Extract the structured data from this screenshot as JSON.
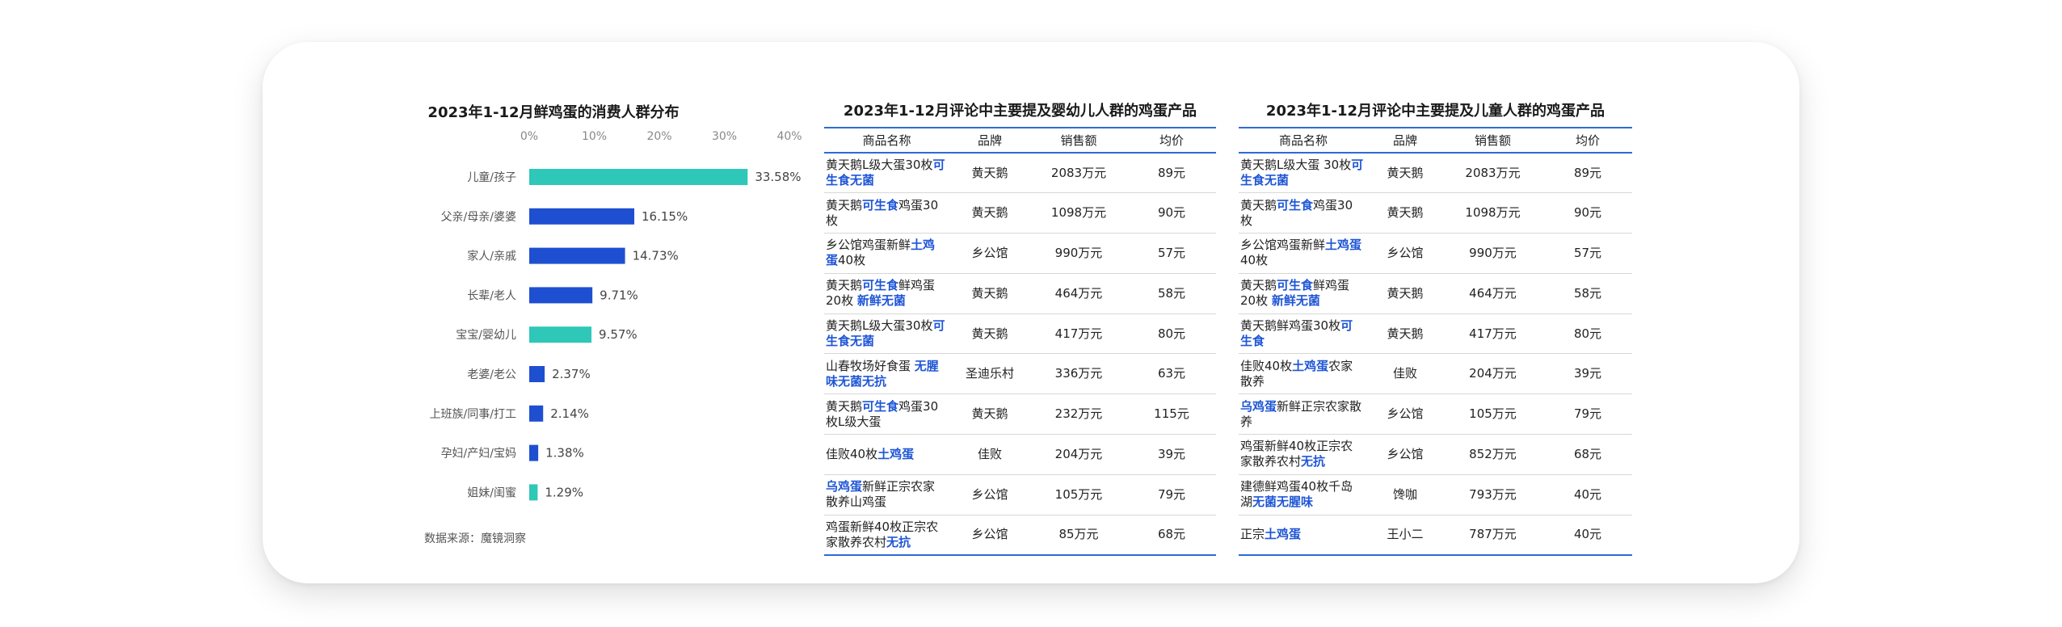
{
  "chart_data": {
    "type": "bar",
    "orientation": "horizontal",
    "title": "2023年1-12月鲜鸡蛋的消费人群分布",
    "xlim": [
      0,
      40
    ],
    "x_ticks": [
      "0%",
      "10%",
      "20%",
      "30%",
      "40%"
    ],
    "categories": [
      "儿童/孩子",
      "父亲/母亲/婆婆",
      "家人/亲戚",
      "长辈/老人",
      "宝宝/婴幼儿",
      "老婆/老公",
      "上班族/同事/打工",
      "孕妇/产妇/宝妈",
      "姐妹/闺蜜"
    ],
    "values": [
      33.58,
      16.15,
      14.73,
      9.71,
      9.57,
      2.37,
      2.14,
      1.38,
      1.29
    ],
    "value_labels": [
      "33.58%",
      "16.15%",
      "14.73%",
      "9.71%",
      "9.57%",
      "2.37%",
      "2.14%",
      "1.38%",
      "1.29%"
    ],
    "bar_colors": [
      "#2ec7b8",
      "#1f4fd1",
      "#1f4fd1",
      "#1f4fd1",
      "#2ec7b8",
      "#1f4fd1",
      "#1f4fd1",
      "#1f4fd1",
      "#2ec7b8"
    ]
  },
  "source_note": "数据来源：魔镜洞察",
  "tables": [
    {
      "title": "2023年1-12月评论中主要提及婴幼儿人群的鸡蛋产品",
      "columns": [
        "商品名称",
        "品牌",
        "销售额",
        "均价"
      ],
      "rows": [
        {
          "name": [
            [
              "黄天鹅L级大蛋30枚",
              false
            ],
            [
              "可生食无菌",
              true
            ]
          ],
          "brand": "黄天鹅",
          "sales": "2083万元",
          "price": "89元"
        },
        {
          "name": [
            [
              "黄天鹅",
              false
            ],
            [
              "可生食",
              true
            ],
            [
              "鸡蛋30枚",
              false
            ]
          ],
          "brand": "黄天鹅",
          "sales": "1098万元",
          "price": "90元"
        },
        {
          "name": [
            [
              "乡公馆鸡蛋新鲜",
              false
            ],
            [
              "土鸡蛋",
              true
            ],
            [
              "40枚",
              false
            ]
          ],
          "brand": "乡公馆",
          "sales": "990万元",
          "price": "57元"
        },
        {
          "name": [
            [
              "黄天鹅",
              false
            ],
            [
              "可生食",
              true
            ],
            [
              "鲜鸡蛋20枚 ",
              false
            ],
            [
              "新鲜无菌",
              true
            ]
          ],
          "brand": "黄天鹅",
          "sales": "464万元",
          "price": "58元"
        },
        {
          "name": [
            [
              "黄天鹅L级大蛋30枚",
              false
            ],
            [
              "可生食无菌",
              true
            ]
          ],
          "brand": "黄天鹅",
          "sales": "417万元",
          "price": "80元"
        },
        {
          "name": [
            [
              "山春牧场好食蛋 ",
              false
            ],
            [
              "无腥味无菌无抗",
              true
            ]
          ],
          "brand": "圣迪乐村",
          "sales": "336万元",
          "price": "63元"
        },
        {
          "name": [
            [
              "黄天鹅",
              false
            ],
            [
              "可生食",
              true
            ],
            [
              "鸡蛋30枚L级大蛋",
              false
            ]
          ],
          "brand": "黄天鹅",
          "sales": "232万元",
          "price": "115元"
        },
        {
          "name": [
            [
              "佳败40枚",
              false
            ],
            [
              "土鸡蛋",
              true
            ]
          ],
          "brand": "佳败",
          "sales": "204万元",
          "price": "39元"
        },
        {
          "name": [
            [
              "乌鸡蛋",
              true
            ],
            [
              "新鲜正宗农家散养山鸡蛋",
              false
            ]
          ],
          "brand": "乡公馆",
          "sales": "105万元",
          "price": "79元"
        },
        {
          "name": [
            [
              "鸡蛋新鲜40枚正宗农家散养农村",
              false
            ],
            [
              "无抗",
              true
            ]
          ],
          "brand": "乡公馆",
          "sales": "85万元",
          "price": "68元"
        }
      ]
    },
    {
      "title": "2023年1-12月评论中主要提及儿童人群的鸡蛋产品",
      "columns": [
        "商品名称",
        "品牌",
        "销售额",
        "均价"
      ],
      "rows": [
        {
          "name": [
            [
              "黄天鹅L级大蛋 30枚",
              false
            ],
            [
              "可生食无菌",
              true
            ]
          ],
          "brand": "黄天鹅",
          "sales": "2083万元",
          "price": "89元"
        },
        {
          "name": [
            [
              "黄天鹅",
              false
            ],
            [
              "可生食",
              true
            ],
            [
              "鸡蛋30枚",
              false
            ]
          ],
          "brand": "黄天鹅",
          "sales": "1098万元",
          "price": "90元"
        },
        {
          "name": [
            [
              "乡公馆鸡蛋新鲜",
              false
            ],
            [
              "土鸡蛋",
              true
            ],
            [
              "40枚",
              false
            ]
          ],
          "brand": "乡公馆",
          "sales": "990万元",
          "price": "57元"
        },
        {
          "name": [
            [
              "黄天鹅",
              false
            ],
            [
              "可生食",
              true
            ],
            [
              "鲜鸡蛋20枚 ",
              false
            ],
            [
              "新鲜无菌",
              true
            ]
          ],
          "brand": "黄天鹅",
          "sales": "464万元",
          "price": "58元"
        },
        {
          "name": [
            [
              "黄天鹅鲜鸡蛋30枚",
              false
            ],
            [
              "可生食",
              true
            ]
          ],
          "brand": "黄天鹅",
          "sales": "417万元",
          "price": "80元"
        },
        {
          "name": [
            [
              "佳败40枚",
              false
            ],
            [
              "土鸡蛋",
              true
            ],
            [
              "农家散养",
              false
            ]
          ],
          "brand": "佳败",
          "sales": "204万元",
          "price": "39元"
        },
        {
          "name": [
            [
              "乌鸡蛋",
              true
            ],
            [
              "新鲜正宗农家散养",
              false
            ]
          ],
          "brand": "乡公馆",
          "sales": "105万元",
          "price": "79元"
        },
        {
          "name": [
            [
              "鸡蛋新鲜40枚正宗农家散养农村",
              false
            ],
            [
              "无抗",
              true
            ]
          ],
          "brand": "乡公馆",
          "sales": "852万元",
          "price": "68元"
        },
        {
          "name": [
            [
              "建德鲜鸡蛋40枚千岛湖",
              false
            ],
            [
              "无菌无腥味",
              true
            ]
          ],
          "brand": "馋咖",
          "sales": "793万元",
          "price": "40元"
        },
        {
          "name": [
            [
              "正宗",
              false
            ],
            [
              "土鸡蛋",
              true
            ]
          ],
          "brand": "王小二",
          "sales": "787万元",
          "price": "40元"
        }
      ]
    }
  ]
}
